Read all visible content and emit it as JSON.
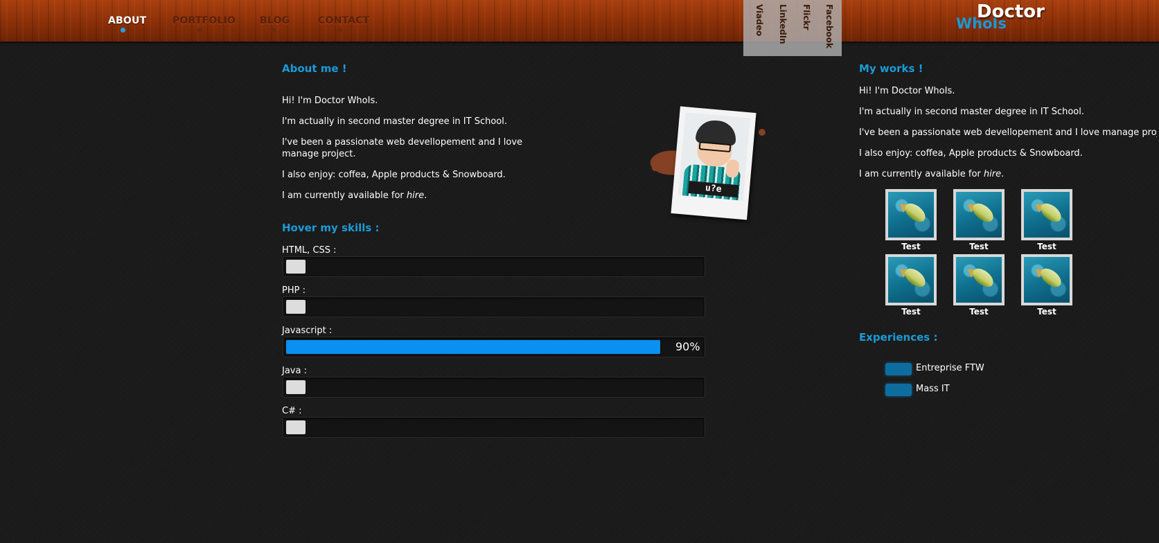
{
  "nav": {
    "items": [
      {
        "label": "ABOUT",
        "active": true
      },
      {
        "label": "PORTFOLIO",
        "active": false
      },
      {
        "label": "BLOG",
        "active": false
      },
      {
        "label": "CONTACT",
        "active": false
      }
    ]
  },
  "social": {
    "links": [
      "Facebook",
      "Flickr",
      "LinkedIn",
      "Viadeo"
    ]
  },
  "logo": {
    "line1": "Doctor",
    "line2": "WhoIs"
  },
  "about": {
    "title": "About me !",
    "paragraphs": [
      "Hi! I'm Doctor WhoIs.",
      "I'm actually in second master degree in IT School.",
      "I've been a passionate web devellopement and I love manage project.",
      "I also enjoy: coffea, Apple products & Snowboard."
    ],
    "hire_prefix": "I am currently available for ",
    "hire_word": "hire",
    "hire_suffix": ".",
    "photo_label": "u?e"
  },
  "skills": {
    "title": "Hover my skills :",
    "items": [
      {
        "label": "HTML, CSS :",
        "hovered": false
      },
      {
        "label": "PHP :",
        "hovered": false
      },
      {
        "label": "Javascript :",
        "hovered": true,
        "percent": 90,
        "percent_label": "90%"
      },
      {
        "label": "Java :",
        "hovered": false
      },
      {
        "label": "C# :",
        "hovered": false
      }
    ],
    "accent_color": "#0a90f0"
  },
  "works": {
    "title": "My works !",
    "paragraphs": [
      "Hi! I'm Doctor WhoIs.",
      "I'm actually in second master degree in IT School.",
      "I've been a passionate web devellopement and I love manage project.",
      "I also enjoy: coffea, Apple products & Snowboard."
    ],
    "hire_prefix": "I am currently available for ",
    "hire_word": "hire",
    "hire_suffix": ".",
    "thumbnails": [
      {
        "caption": "Test"
      },
      {
        "caption": "Test"
      },
      {
        "caption": "Test"
      },
      {
        "caption": "Test"
      },
      {
        "caption": "Test"
      },
      {
        "caption": "Test"
      }
    ]
  },
  "experiences": {
    "title": "Experiences :",
    "items": [
      {
        "label": "Entreprise FTW"
      },
      {
        "label": "Mass IT"
      }
    ]
  },
  "colors": {
    "accent_blue": "#1a9bd8",
    "header_wood": "#8a2f08",
    "background": "#1c1c1c"
  }
}
